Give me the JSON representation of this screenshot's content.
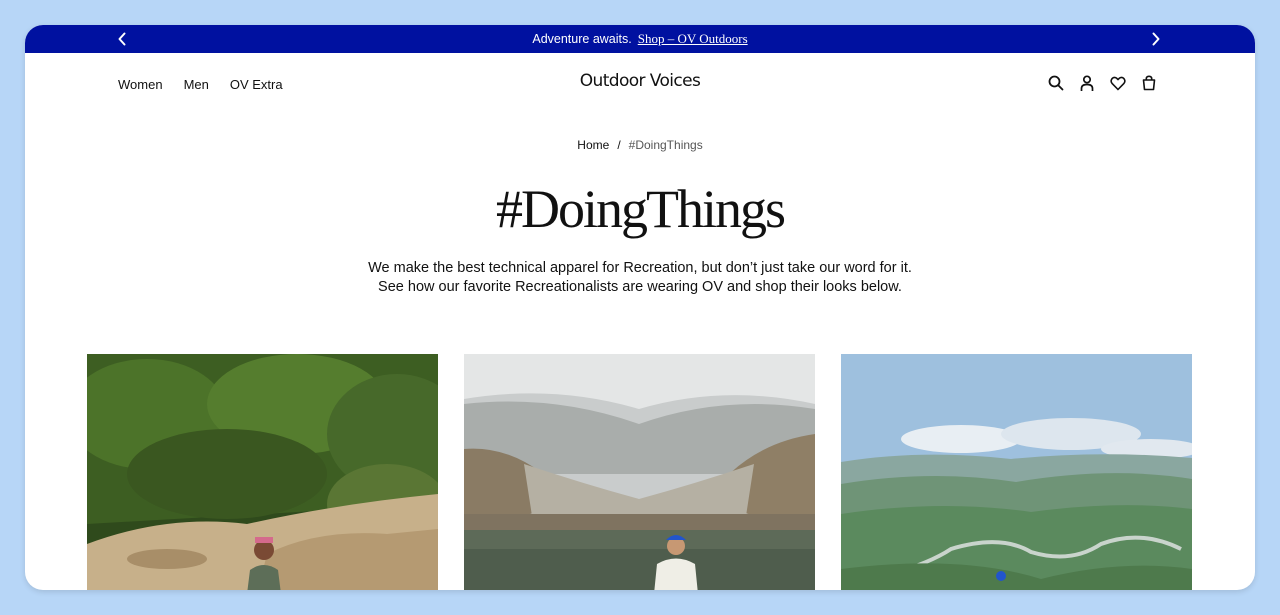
{
  "announcement": {
    "text": "Adventure awaits.",
    "link_label": "Shop – OV Outdoors"
  },
  "nav": {
    "items": [
      {
        "label": "Women"
      },
      {
        "label": "Men"
      },
      {
        "label": "OV Extra"
      }
    ]
  },
  "brand": "Outdoor Voices",
  "header_icons": [
    "search-icon",
    "account-icon",
    "wishlist-icon",
    "bag-icon"
  ],
  "breadcrumb": {
    "home": "Home",
    "separator": "/",
    "current": "#DoingThings"
  },
  "page": {
    "title": "#DoingThings",
    "description_line1": "We make the best technical apparel for Recreation, but don’t just take our word for it.",
    "description_line2": "See how our favorite Recreationalists are wearing OV and shop their looks below."
  },
  "colors": {
    "announcement_bg": "#0011a0",
    "page_bg": "#b7d6f7"
  }
}
